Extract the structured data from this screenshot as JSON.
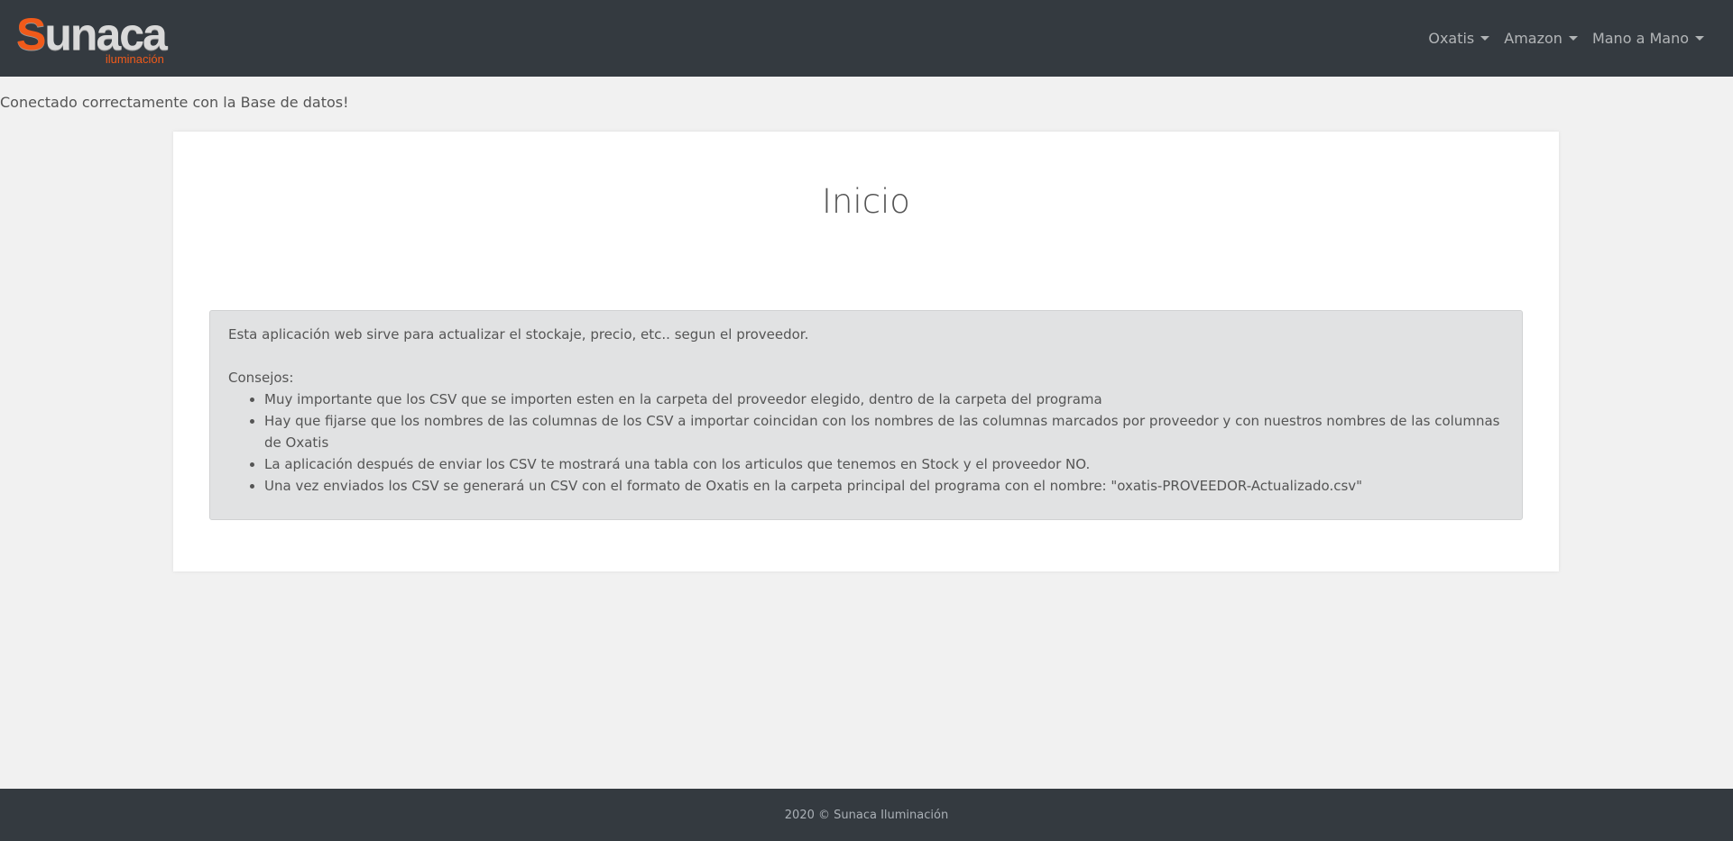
{
  "brand": {
    "logo_first": "S",
    "logo_rest": "unaca",
    "logo_sub": "iluminación",
    "accent_color": "#f05a1a"
  },
  "nav": {
    "items": [
      {
        "label": "Oxatis"
      },
      {
        "label": "Amazon"
      },
      {
        "label": "Mano a Mano"
      }
    ]
  },
  "status": {
    "db_message": "Conectado correctamente con la Base de datos!"
  },
  "main": {
    "title": "Inicio",
    "intro": "Esta aplicación web sirve para actualizar el stockaje, precio, etc.. segun el proveedor.",
    "tips_label": "Consejos:",
    "tips": [
      "Muy importante que los CSV que se importen esten en la carpeta del proveedor elegido, dentro de la carpeta del programa",
      "Hay que fijarse que los nombres de las columnas de los CSV a importar coincidan con los nombres de las columnas marcados por proveedor y con nuestros nombres de las columnas de Oxatis",
      "La aplicación después de enviar los CSV te mostrará una tabla con los articulos que tenemos en Stock y el proveedor NO.",
      "Una vez enviados los CSV se generará un CSV con el formato de Oxatis en la carpeta principal del programa con el nombre: \"oxatis-PROVEEDOR-Actualizado.csv\""
    ]
  },
  "footer": {
    "text": "2020 © Sunaca Iluminación"
  }
}
